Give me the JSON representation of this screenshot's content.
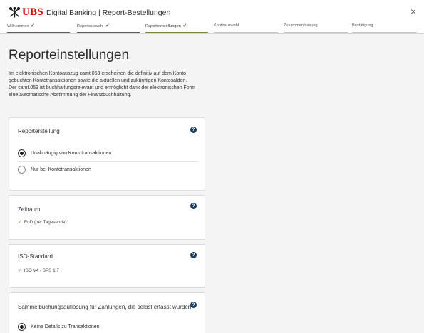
{
  "header": {
    "logo_text": "UBS",
    "title": "Digital Banking | Report-Bestellungen",
    "close_symbol": "×"
  },
  "steps": [
    {
      "label": "Willkommen",
      "state": "done",
      "check": "✔"
    },
    {
      "label": "Reportauswahl",
      "state": "done",
      "check": "✔"
    },
    {
      "label": "Reporteinstellungen",
      "state": "active",
      "check": "✔"
    },
    {
      "label": "Kontoauswahl",
      "state": "todo",
      "check": ""
    },
    {
      "label": "Zusammenfassung",
      "state": "todo",
      "check": ""
    },
    {
      "label": "Bestätigung",
      "state": "todo",
      "check": ""
    }
  ],
  "page": {
    "title": "Reporteinstellungen",
    "intro_lines": [
      "Im elektronischen Kontoauszug camt.053 erscheinen die definitiv auf dem Konto",
      "gebuchten Kontotransaktionen sowie die aktuellen und zukünftigen Kontosalden.",
      "Der camt.053 ist buchhaltungsrelevant und ermöglicht dank der elektronischen Form",
      "eine automatische Abstimmung der Finanzbuchhaltung."
    ]
  },
  "cards": {
    "reporterstellung": {
      "title": "Reporterstellung",
      "help": "?",
      "options": [
        {
          "label": "Unabhängig von Kontotransaktionen",
          "checked": true
        },
        {
          "label": "Nur bei Kontotransaktionen",
          "checked": false
        }
      ]
    },
    "zeitraum": {
      "title": "Zeitraum",
      "help": "?",
      "check": "✓",
      "value": "EoD (per Tagesende)"
    },
    "iso": {
      "title": "ISO-Standard",
      "help": "?",
      "check": "✓",
      "value": "ISO V4 - SPS 1.7"
    },
    "sammel": {
      "title": "Sammelbuchungsauflösung für Zahlungen, die selbst erfasst wurden",
      "help": "?",
      "options": [
        {
          "label": "Keine Details zu Transaktionen",
          "checked": true
        }
      ]
    }
  },
  "colors": {
    "brand_red": "#e60000",
    "step_active": "#76883e",
    "help_icon": "#1b3a5c"
  }
}
